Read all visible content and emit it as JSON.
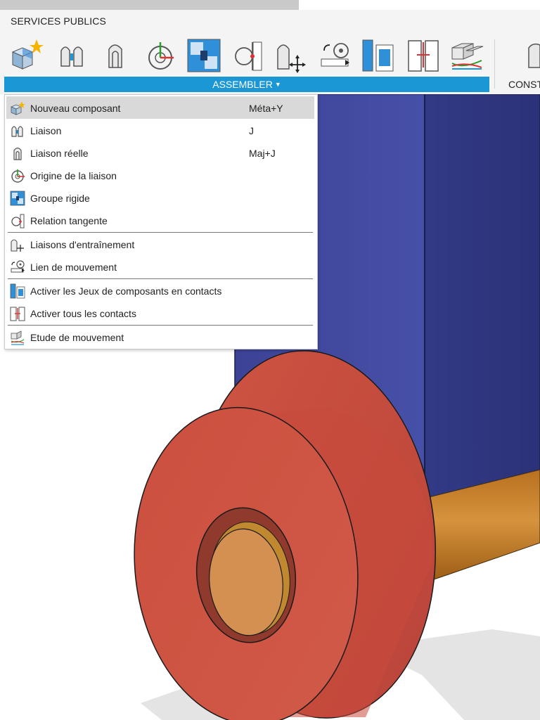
{
  "ribbon": {
    "tab_label": "SERVICES PUBLICS",
    "group_label": "ASSEMBLER",
    "next_group_label": "CONST",
    "tools": [
      "new-component-icon",
      "joint-icon",
      "as-built-joint-icon",
      "joint-origin-icon",
      "rigid-group-icon",
      "tangent-relationship-icon",
      "drive-joints-icon",
      "motion-link-icon",
      "enable-contact-sets-icon",
      "enable-all-contact-icon",
      "motion-study-icon"
    ]
  },
  "menu": {
    "items": [
      {
        "label": "Nouveau composant",
        "shortcut": "Méta+Y",
        "icon": "new-component-icon",
        "highlighted": true
      },
      {
        "label": "Liaison",
        "shortcut": "J",
        "icon": "joint-icon"
      },
      {
        "label": "Liaison réelle",
        "shortcut": "Maj+J",
        "icon": "as-built-joint-icon"
      },
      {
        "label": "Origine de la liaison",
        "shortcut": "",
        "icon": "joint-origin-icon"
      },
      {
        "label": "Groupe rigide",
        "shortcut": "",
        "icon": "rigid-group-icon"
      },
      {
        "label": "Relation tangente",
        "shortcut": "",
        "icon": "tangent-relationship-icon"
      },
      {
        "label": "Liaisons d'entraînement",
        "shortcut": "",
        "icon": "drive-joints-icon"
      },
      {
        "label": "Lien de mouvement",
        "shortcut": "",
        "icon": "motion-link-icon"
      },
      {
        "label": "Activer les Jeux de composants en contacts",
        "shortcut": "",
        "icon": "enable-contact-sets-icon"
      },
      {
        "label": "Activer tous les contacts",
        "shortcut": "",
        "icon": "enable-all-contact-icon"
      },
      {
        "label": "Etude de mouvement",
        "shortcut": "",
        "icon": "motion-study-icon"
      }
    ]
  },
  "colors": {
    "accent": "#1c97d6",
    "box_face": "#43499c",
    "box_side": "#363c84",
    "wheel": "#d25443",
    "hub": "#d48e4d",
    "axle": "#c9822d"
  }
}
